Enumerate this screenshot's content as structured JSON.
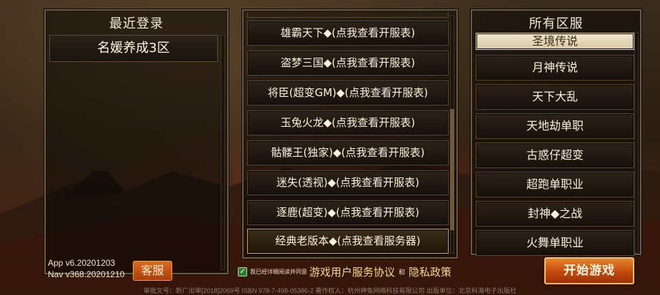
{
  "recent": {
    "title": "最近登录",
    "servers": [
      "名媛养成3区"
    ]
  },
  "middle": {
    "items": [
      "雄霸天下◆(点我查看开服表)",
      "盗梦三国◆(点我查看开服表)",
      "将臣(超变GM)◆(点我查看开服表)",
      "玉兔火龙◆(点我查看开服表)",
      "骷髅王(独家)◆(点我查看开服表)",
      "迷失(透视)◆(点我查看开服表)",
      "逐鹿(超变)◆(点我查看开服表)",
      "经典老版本◆(点我查看服务器)"
    ],
    "selected_index": 7
  },
  "all": {
    "title": "所有区服",
    "items": [
      "圣境传说",
      "月神传说",
      "天下大乱",
      "天地劫单职",
      "古惑仔超变",
      "超跑单职业",
      "封神◆之战",
      "火舞单职业"
    ],
    "selected_index": 0
  },
  "version": {
    "app": "App v6.20201203",
    "nav": "Nav v368.20201210"
  },
  "buttons": {
    "service": "客服",
    "start": "开始游戏"
  },
  "agreement": {
    "checked": true,
    "prefix": "我已经详细阅读并同意",
    "user_agreement": "游戏用户服务协议",
    "and": "和",
    "privacy": "隐私政策"
  },
  "footer": "审批文号：新广出审[2018]2069号 ISBN 978-7-498-05386-2 著作权人：杭州神兔网络科技有限公司 出版单位：北京科海电子出版社"
}
